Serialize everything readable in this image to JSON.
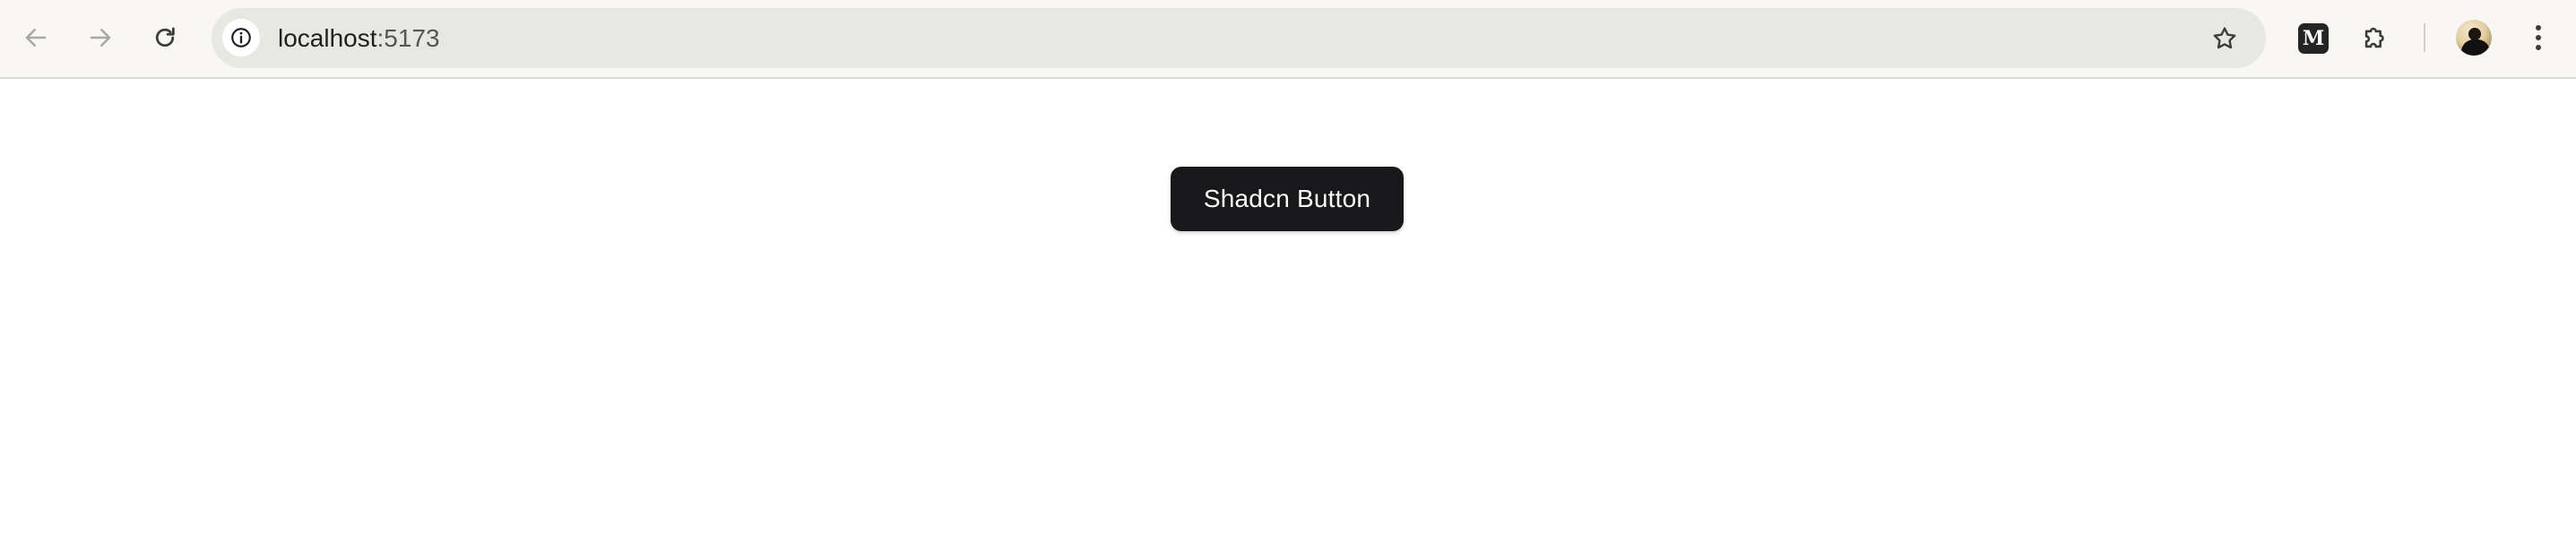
{
  "browser": {
    "back_icon": "arrow-left-icon",
    "forward_icon": "arrow-right-icon",
    "reload_icon": "reload-icon",
    "site_info_icon": "info-icon",
    "url_host": "localhost",
    "url_port": ":5173",
    "bookmark_icon": "star-icon",
    "extensions": [
      {
        "name": "Medium",
        "label": "M"
      },
      {
        "name": "Extensions",
        "icon": "puzzle-icon"
      }
    ],
    "menu_icon": "kebab-menu-icon"
  },
  "page": {
    "button_label": "Shadcn Button"
  },
  "colors": {
    "toolbar_bg": "#f8f7f3",
    "omnibox_bg": "#e8e8e3",
    "button_bg": "#18181b",
    "button_text": "#fafafa"
  }
}
